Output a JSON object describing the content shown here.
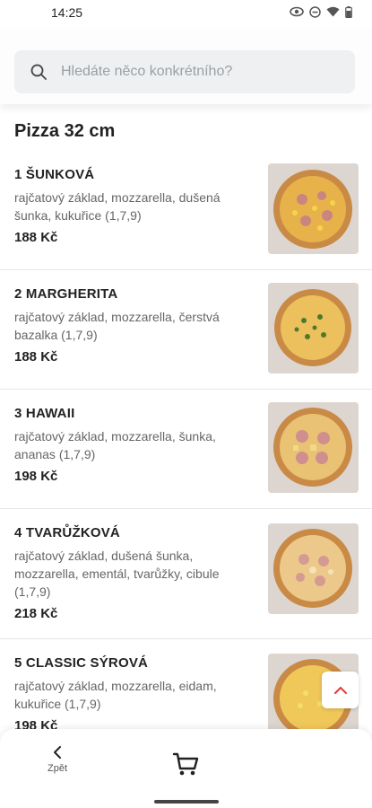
{
  "status_bar": {
    "time": "14:25"
  },
  "search": {
    "placeholder": "Hledáte něco konkrétního?"
  },
  "section": {
    "title": "Pizza 32 cm"
  },
  "items": [
    {
      "name": "1 ŠUNKOVÁ",
      "desc": "rajčatový základ, mozzarella, dušená šunka, kukuřice (1,7,9)",
      "price": "188 Kč"
    },
    {
      "name": "2 MARGHERITA",
      "desc": "rajčatový základ, mozzarella, čerstvá bazalka (1,7,9)",
      "price": "188 Kč"
    },
    {
      "name": "3 HAWAII",
      "desc": "rajčatový základ, mozzarella, šunka, ananas (1,7,9)",
      "price": "198 Kč"
    },
    {
      "name": "4 TVARŮŽKOVÁ",
      "desc": "rajčatový základ, dušená šunka, mozzarella, ementál, tvarůžky, cibule (1,7,9)",
      "price": "218 Kč"
    },
    {
      "name": "5 CLASSIC SÝROVÁ",
      "desc": "rajčatový základ, mozzarella, eidam, kukuřice (1,7,9)",
      "price": "198 Kč"
    }
  ],
  "bottom_nav": {
    "back_label": "Zpět"
  },
  "icons": {
    "search": "search-icon",
    "back": "chevron-left-icon",
    "cart": "cart-icon",
    "scroll_top": "chevron-up-icon",
    "status": [
      "eye-icon",
      "do-not-disturb-icon",
      "wifi-icon",
      "battery-icon"
    ]
  },
  "colors": {
    "accent": "#e53935",
    "search_bg": "#eef0f1",
    "text": "#222222",
    "muted": "#666666"
  }
}
